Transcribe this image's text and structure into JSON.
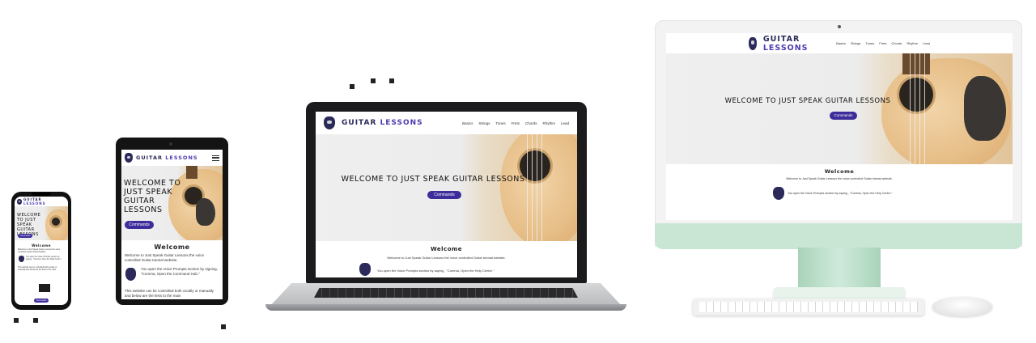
{
  "site": {
    "brand_left": "GUITAR",
    "brand_right": "LESSONS",
    "nav": [
      "Basics",
      "Strings",
      "Tunes",
      "Frets",
      "Chords",
      "Rhythm",
      "Lead"
    ],
    "hero_title": "WELCOME TO JUST SPEAK GUITAR LESSONS",
    "hero_button": "Commands",
    "welcome_heading": "Welcome",
    "intro": "Welcome to Just Speak Guitar Lessons the voice controlled Guitar tutorial website.",
    "voice_prompt": "You open the Voice Prompts section by saying , \"Comma, Open the Help Centre.\"",
    "tablet_intro": "Welcome to Just Speak Guitar Lessons the voice controlled Guitar tutorial website.",
    "tablet_voice": "You open the Voice Prompts section by signing, \"Comma, Open the Command Hub.\"",
    "tablet_more": "This website can be controlled both vocally or manually and below are the links to the main"
  },
  "tablet": {
    "hero_title": "WELCOME TO JUST SPEAK GUITAR LESSONS",
    "menu_icon": "hamburger-menu-icon"
  },
  "colors": {
    "brand": "#2b2a5a",
    "accent": "#4b3bb0",
    "button": "#3c2d9a",
    "desktop_chin": "#c9e5d3"
  }
}
